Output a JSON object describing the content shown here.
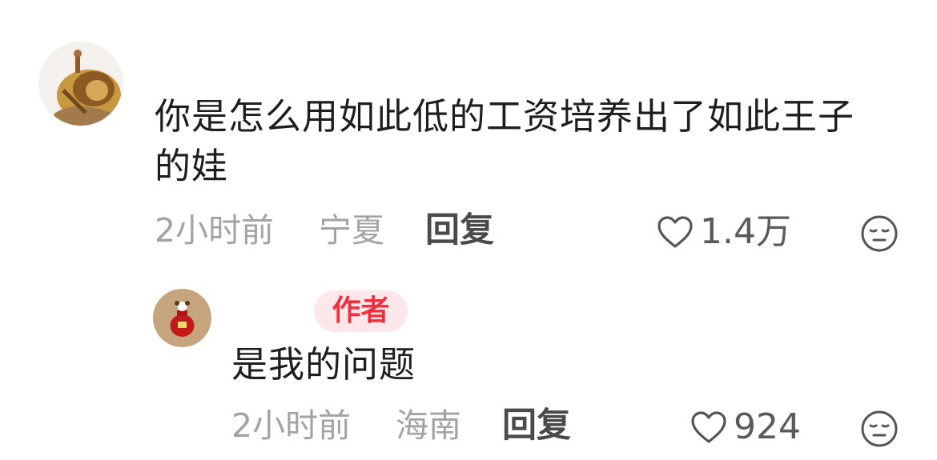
{
  "comments": [
    {
      "avatar_icon": "lion-avatar",
      "text": "你是怎么用如此低的工资培养出了如此王子的娃",
      "time": "2小时前",
      "location": "宁夏",
      "reply_label": "回复",
      "like_count": "1.4万",
      "like_icon": "heart-outline",
      "dislike_icon": "unamused-face"
    },
    {
      "avatar_icon": "red-envelope-avatar",
      "badge": "作者",
      "text": "是我的问题",
      "time": "2小时前",
      "location": "海南",
      "reply_label": "回复",
      "like_count": "924",
      "like_icon": "heart-outline",
      "dislike_icon": "unamused-face"
    }
  ],
  "colors": {
    "text": "#1e1e1e",
    "meta": "#a3a3a3",
    "reply": "#4a4a4a",
    "badge_bg": "#fde7ea",
    "badge_text": "#f0303f"
  }
}
